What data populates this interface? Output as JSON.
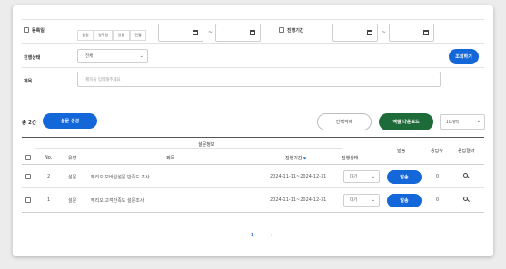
{
  "filters": {
    "reg_date_label": "등록일",
    "quick_ranges": [
      "금일",
      "일주일",
      "당월",
      "전월"
    ],
    "date_separator": "~",
    "period_label": "진행기간",
    "status_label": "진행상태",
    "status_value": "전체",
    "title_label": "제목",
    "title_placeholder": "제목을 입력해주세요",
    "search_button": "조회하기"
  },
  "toolbar": {
    "total_count": "총 2건",
    "create_button": "설문 생성",
    "delete_button": "선택삭제",
    "excel_button": "엑셀 다운로드",
    "page_size": "10개씩"
  },
  "table": {
    "group_header": "설문정보",
    "headers": {
      "no": "No.",
      "type": "유형",
      "title": "제목",
      "period": "진행기간",
      "status": "진행상태",
      "send": "발송",
      "responses": "응답수",
      "result": "응답결과"
    },
    "rows": [
      {
        "no": "2",
        "type": "설문",
        "title": "뿌리오 모바일설문 만족도 조사",
        "period": "2024-11-11~2024-12-31",
        "status": "대기",
        "send": "발송",
        "responses": "0"
      },
      {
        "no": "1",
        "type": "설문",
        "title": "뿌리오 고객만족도 설문조사",
        "period": "2024-11-11~2024-12-31",
        "status": "대기",
        "send": "발송",
        "responses": "0"
      }
    ]
  },
  "pagination": {
    "prev": "‹",
    "current": "1",
    "next": "›"
  },
  "colors": {
    "primary": "#1467d9",
    "excel": "#1e6b3a"
  }
}
